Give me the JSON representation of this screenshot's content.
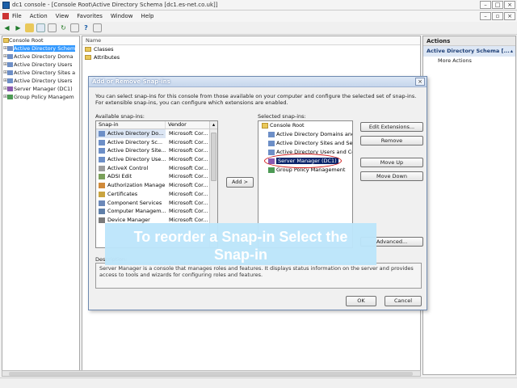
{
  "window": {
    "title": "dc1 console - [Console Root\\Active Directory Schema [dc1.es-net.co.uk]]",
    "menu": [
      "File",
      "Action",
      "View",
      "Favorites",
      "Window",
      "Help"
    ]
  },
  "tree": {
    "root": "Console Root",
    "items": [
      "Active Directory Schem",
      "Active Directory Doma",
      "Active Directory Users",
      "Active Directory Sites a",
      "Active Directory Users",
      "Server Manager (DC1)",
      "Group Policy Managem"
    ]
  },
  "list": {
    "header": "Name",
    "rows": [
      "Classes",
      "Attributes"
    ]
  },
  "actions": {
    "header": "Actions",
    "sub_header": "Active Directory Schema [...",
    "items": [
      "More Actions"
    ]
  },
  "dialog": {
    "title": "Add or Remove Snap-ins",
    "description": "You can select snap-ins for this console from those available on your computer and configure the selected set of snap-ins. For extensible snap-ins, you can configure which extensions are enabled.",
    "available_label": "Available snap-ins:",
    "available_columns": [
      "Snap-in",
      "Vendor"
    ],
    "available_rows": [
      {
        "name": "Active Directory Do...",
        "vendor": "Microsoft Cor..."
      },
      {
        "name": "Active Directory Sc...",
        "vendor": "Microsoft Cor..."
      },
      {
        "name": "Active Directory Site...",
        "vendor": "Microsoft Cor..."
      },
      {
        "name": "Active Directory Use...",
        "vendor": "Microsoft Cor..."
      },
      {
        "name": "ActiveX Control",
        "vendor": "Microsoft Cor..."
      },
      {
        "name": "ADSI Edit",
        "vendor": "Microsoft Cor..."
      },
      {
        "name": "Authorization Manager",
        "vendor": "Microsoft Cor..."
      },
      {
        "name": "Certificates",
        "vendor": "Microsoft Cor..."
      },
      {
        "name": "Component Services",
        "vendor": "Microsoft Cor..."
      },
      {
        "name": "Computer Managem...",
        "vendor": "Microsoft Cor..."
      },
      {
        "name": "Device Manager",
        "vendor": "Microsoft Cor..."
      }
    ],
    "add_button": "Add >",
    "selected_label": "Selected snap-ins:",
    "selected_root": "Console Root",
    "selected_items": [
      "Active Directory Domains and T",
      "Active Directory Sites and Serv",
      "Active Directory Users and Com",
      "Server Manager (DC1)",
      "Group Policy Management"
    ],
    "highlighted_index": 3,
    "buttons": {
      "edit_extensions": "Edit Extensions...",
      "remove": "Remove",
      "move_up": "Move Up",
      "move_down": "Move Down",
      "advanced": "Advanced...",
      "ok": "OK",
      "cancel": "Cancel"
    },
    "description_label": "Description:",
    "description_text": "Server Manager is a console that manages roles and features. It displays status information on the server and provides access to tools and wizards for configuring roles and features."
  },
  "overlay": {
    "line1": "To reorder a Snap-in Select the",
    "line2": "Snap-in"
  },
  "colors": {
    "overlay_bg": "#bde6fb",
    "highlight": "#0a246a",
    "ellipse": "#d21f1f"
  }
}
